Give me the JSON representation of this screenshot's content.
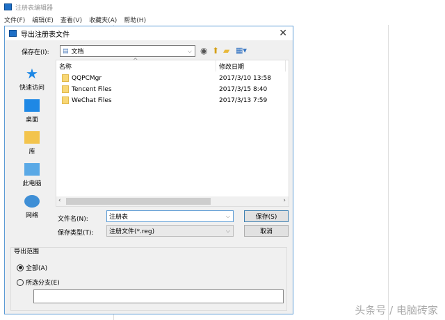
{
  "app": {
    "title": "注册表编辑器",
    "menu": [
      "文件(F)",
      "编辑(E)",
      "查看(V)",
      "收藏夹(A)",
      "帮助(H)"
    ]
  },
  "dialog": {
    "title": "导出注册表文件",
    "save_in_label": "保存在(I):",
    "save_in_value": "文档",
    "places": [
      "快速访问",
      "桌面",
      "库",
      "此电脑",
      "网络"
    ],
    "columns": [
      "名称",
      "修改日期"
    ],
    "files": [
      {
        "name": "QQPCMgr",
        "date": "2017/3/10 13:58"
      },
      {
        "name": "Tencent Files",
        "date": "2017/3/15 8:40"
      },
      {
        "name": "WeChat Files",
        "date": "2017/3/13 7:59"
      }
    ],
    "filename_label": "文件名(N):",
    "filename_value": "注册表",
    "filetype_label": "保存类型(T):",
    "filetype_value": "注册文件(*.reg)",
    "save_button": "保存(S)",
    "cancel_button": "取消",
    "range": {
      "title": "导出范围",
      "all": "全部(A)",
      "branch": "所选分支(E)",
      "branch_value": ""
    }
  },
  "watermark": "头条号 / 电脑砖家"
}
